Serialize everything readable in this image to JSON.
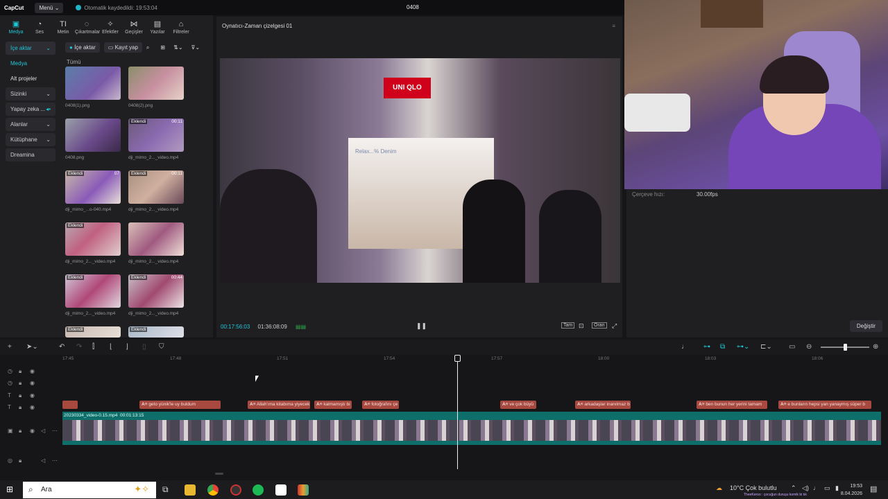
{
  "app": {
    "logo": "CapCut",
    "menu": "Menü",
    "autosave": "Otomatik kaydedildi: 19:53:04",
    "project_name": "0408"
  },
  "toolbar": [
    {
      "label": "Medya",
      "icon": "media-icon"
    },
    {
      "label": "Ses",
      "icon": "audio-icon"
    },
    {
      "label": "Metin",
      "icon": "text-icon"
    },
    {
      "label": "Çıkartmalar",
      "icon": "sticker-icon"
    },
    {
      "label": "Efektler",
      "icon": "effects-icon"
    },
    {
      "label": "Geçişler",
      "icon": "transition-icon"
    },
    {
      "label": "Yazılar",
      "icon": "captions-icon"
    },
    {
      "label": "Filtreler",
      "icon": "filter-icon"
    }
  ],
  "sidenav": [
    {
      "label": "İçe aktar"
    },
    {
      "label": "Medya"
    },
    {
      "label": "Alt projeler"
    },
    {
      "label": "Sizinki"
    },
    {
      "label": "Yapay zeka ..."
    },
    {
      "label": "Alanlar"
    },
    {
      "label": "Kütüphane"
    },
    {
      "label": "Dreamina"
    }
  ],
  "media_toolbar": {
    "import": "İçe aktar",
    "record": "Kayıt yap"
  },
  "filter_all": "Tümü",
  "media_items": [
    {
      "name": "0408(1).png",
      "tag": "",
      "dur": ""
    },
    {
      "name": "0408(2).png",
      "tag": "",
      "dur": ""
    },
    {
      "name": "0408.png",
      "tag": "",
      "dur": ""
    },
    {
      "name": "dji_mimo_2..._video.mp4",
      "tag": "Eklendi",
      "dur": "00:11"
    },
    {
      "name": "dji_mimo_...o-040.mp4",
      "tag": "Eklendi",
      "dur": "07"
    },
    {
      "name": "dji_mimo_2..._video.mp4",
      "tag": "Eklendi",
      "dur": "00:11"
    },
    {
      "name": "dji_mimo_2..._video.mp4",
      "tag": "Eklendi",
      "dur": ""
    },
    {
      "name": "dji_mimo_2..._video.mp4",
      "tag": "",
      "dur": ""
    },
    {
      "name": "dji_mimo_2..._video.mp4",
      "tag": "Eklendi",
      "dur": ""
    },
    {
      "name": "dji_mimo_2..._video.mp4",
      "tag": "Eklendi",
      "dur": "00:44"
    },
    {
      "name": "",
      "tag": "Eklendi",
      "dur": ""
    },
    {
      "name": "",
      "tag": "Eklendi",
      "dur": ""
    }
  ],
  "player": {
    "title": "Oynatıcı-Zaman çizelgesi 01",
    "current_time": "00:17:56:03",
    "total_time": "01:36:08:09",
    "full_label": "Tam",
    "ratio_label": "Oran",
    "store_sign": "UNI QLO",
    "store_text": "Relax...% Denim"
  },
  "properties": {
    "frame_rate_label": "Çerçeve hızı:",
    "frame_rate_value": "30.00fps",
    "change_button": "Değiştir"
  },
  "ruler": [
    "17:45",
    "17:48",
    "17:51",
    "17:54",
    "17:57",
    "18:00",
    "18:03",
    "18:06"
  ],
  "captions": [
    {
      "text": ""
    },
    {
      "text": "geto yünik'le uy buldum"
    },
    {
      "text": "Allah'ıma kitabıma yiyecek"
    },
    {
      "text": "kalmamıştı bi"
    },
    {
      "text": "fotoğrafını çe"
    },
    {
      "text": "ve çok büyü"
    },
    {
      "text": "arkadaşlar inanılmaz b"
    },
    {
      "text": "ben bunun her yerini tamam"
    },
    {
      "text": "e bunların hepsi yan yanaymış süper b"
    }
  ],
  "video_track": {
    "label": "20230334_video-0.15.mp4",
    "duration": "00:01:13:15"
  },
  "taskbar": {
    "search": "Ara",
    "weather": "10°C  Çok bulutlu",
    "time": "19:53",
    "date": "8.04.2026",
    "overlay_text": "TheeKeroo : çocuğun duruşu komik bi tık"
  }
}
